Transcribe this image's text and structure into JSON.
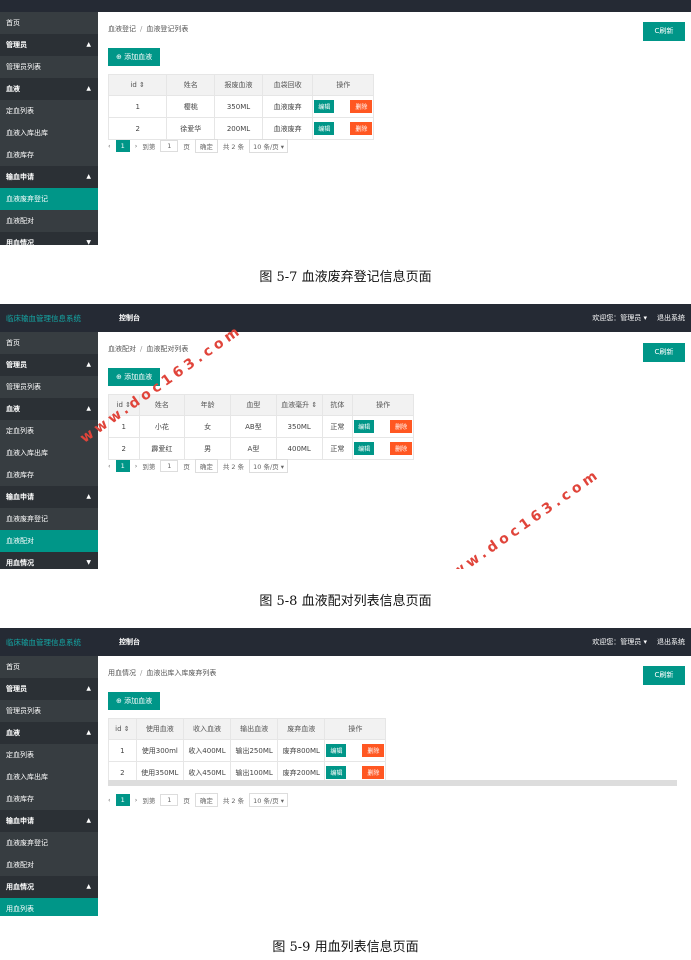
{
  "system_title": "临床输血管理信息系统",
  "top_tab": "控制台",
  "welcome": "欢迎您：管理员 ▾",
  "logout": "退出系统",
  "refresh": "C刷新",
  "add_blood": "⊕ 添加血液",
  "pager": {
    "page": "1",
    "goto": "到第",
    "page_input": "1",
    "page_unit": "页",
    "confirm": "确定",
    "total": "共 2 条",
    "per_page": "10 条/页 ▾"
  },
  "actions": {
    "edit": "编辑",
    "delete": "删除"
  },
  "menu": {
    "home": "首页",
    "admin": "管理员",
    "admin_list": "管理员列表",
    "blood": "血液",
    "blood_list": "定血列表",
    "blood_inout": "血液入库出库",
    "blood_stock": "血液库存",
    "apply": "输血申请",
    "discard_reg": "血液废弃登记",
    "match": "血液配对",
    "usage": "用血情况",
    "usage_list": "用血列表"
  },
  "panel1": {
    "crumb1": "血液登记",
    "crumb2": "血液登记列表",
    "headers": [
      "id ⇕",
      "姓名",
      "报废血液",
      "血袋回收",
      "操作"
    ],
    "rows": [
      [
        "1",
        "樱桃",
        "350ML",
        "血液废弃"
      ],
      [
        "2",
        "徐爱华",
        "200ML",
        "血液废弃"
      ]
    ],
    "caption": "图 5-7 血液废弃登记信息页面"
  },
  "panel2": {
    "crumb1": "血液配对",
    "crumb2": "血液配对列表",
    "headers": [
      "id ⇕",
      "姓名",
      "年龄",
      "血型",
      "血液毫升 ⇕",
      "抗体",
      "操作"
    ],
    "rows": [
      [
        "1",
        "小花",
        "女",
        "AB型",
        "350ML",
        "正常"
      ],
      [
        "2",
        "霹爱红",
        "男",
        "A型",
        "400ML",
        "正常"
      ]
    ],
    "caption": "图 5-8 血液配对列表信息页面",
    "watermark": "www.doc163.com"
  },
  "panel3": {
    "crumb1": "用血情况",
    "crumb2": "血液出库入库废弃列表",
    "headers": [
      "id ⇕",
      "使用血液",
      "收入血液",
      "输出血液",
      "废弃血液",
      "操作"
    ],
    "rows": [
      [
        "1",
        "使用300ml",
        "收入400ML",
        "输出250ML",
        "废弃800ML"
      ],
      [
        "2",
        "使用350ML",
        "收入450ML",
        "输出100ML",
        "废弃200ML"
      ]
    ],
    "caption": "图 5-9 用血列表信息页面"
  }
}
